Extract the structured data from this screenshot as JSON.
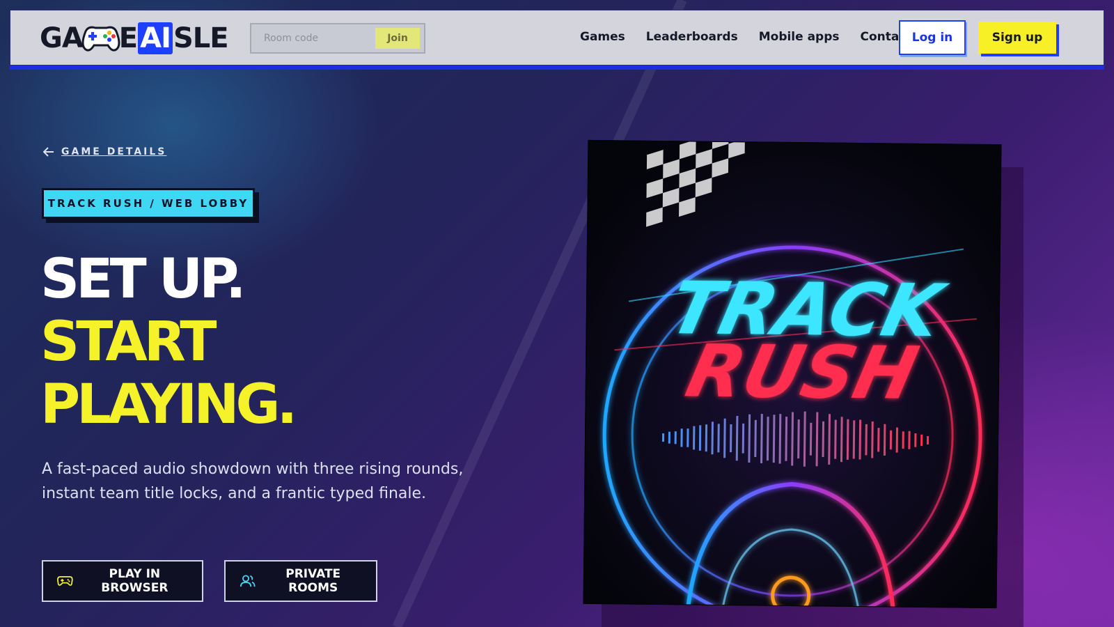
{
  "brand": {
    "logo_prefix": "GA",
    "logo_mid": "E",
    "logo_ai": "AI",
    "logo_suffix": "SLE"
  },
  "nav": {
    "room_placeholder": "Room code",
    "join_label": "Join",
    "links": [
      "Games",
      "Leaderboards",
      "Mobile apps",
      "Contact"
    ],
    "login_label": "Log in",
    "signup_label": "Sign up"
  },
  "hero": {
    "back_label": "GAME DETAILS",
    "chip": "TRACK RUSH / WEB LOBBY",
    "headline_line1": "SET UP.",
    "headline_line2": "START",
    "headline_line3": "PLAYING.",
    "description": "A fast-paced audio showdown with three rising rounds, instant team title locks, and a frantic typed finale.",
    "play_label": "PLAY IN BROWSER",
    "rooms_label": "PRIVATE ROOMS"
  },
  "art": {
    "title_line1": "TRACK",
    "title_line2": "RUSH"
  },
  "colors": {
    "accent_yellow": "#f6f22a",
    "accent_blue": "#1f3fff",
    "chip_cyan": "#40d7f5"
  }
}
